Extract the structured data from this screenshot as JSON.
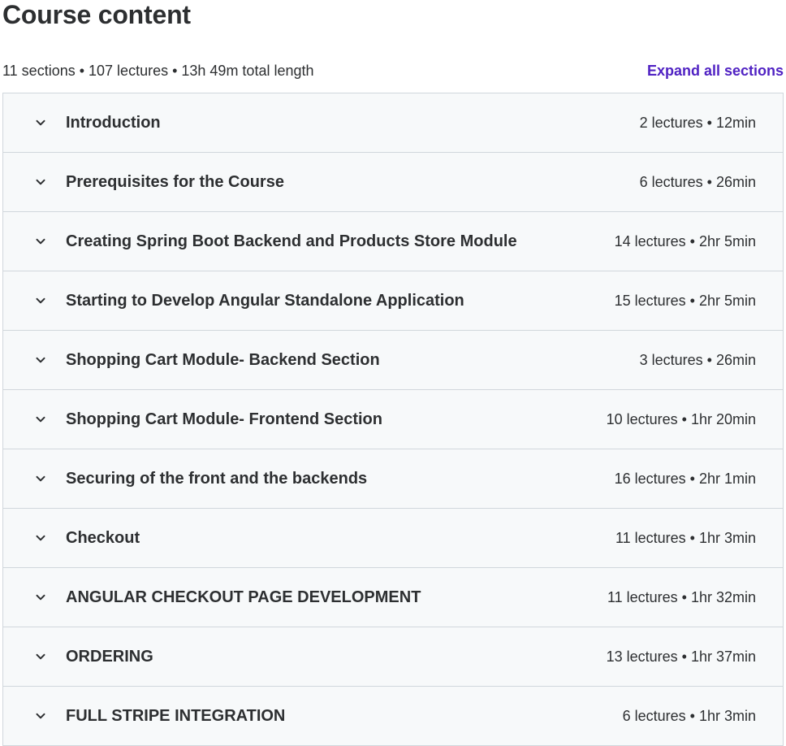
{
  "header": {
    "title": "Course content",
    "summary": "11 sections • 107 lectures • 13h 49m total length",
    "expand_all_label": "Expand all sections"
  },
  "colors": {
    "accent": "#5022c3",
    "row_background": "#f7f9fa",
    "border": "#d1d7dc",
    "text": "#2d2f31"
  },
  "icons": {
    "section_toggle": "chevron-down-icon"
  },
  "sections": [
    {
      "title": "Introduction",
      "meta": "2 lectures • 12min"
    },
    {
      "title": "Prerequisites for the Course",
      "meta": "6 lectures • 26min"
    },
    {
      "title": "Creating Spring Boot Backend and Products Store Module",
      "meta": "14 lectures • 2hr 5min"
    },
    {
      "title": "Starting to Develop Angular Standalone Application",
      "meta": "15 lectures • 2hr 5min"
    },
    {
      "title": "Shopping Cart Module- Backend Section",
      "meta": "3 lectures • 26min"
    },
    {
      "title": "Shopping Cart Module- Frontend Section",
      "meta": "10 lectures • 1hr 20min"
    },
    {
      "title": "Securing of the front and the backends",
      "meta": "16 lectures • 2hr 1min"
    },
    {
      "title": "Checkout",
      "meta": "11 lectures • 1hr 3min"
    },
    {
      "title": "ANGULAR CHECKOUT PAGE DEVELOPMENT",
      "meta": "11 lectures • 1hr 32min"
    },
    {
      "title": "ORDERING",
      "meta": "13 lectures • 1hr 37min"
    },
    {
      "title": "FULL STRIPE INTEGRATION",
      "meta": "6 lectures • 1hr 3min"
    }
  ]
}
